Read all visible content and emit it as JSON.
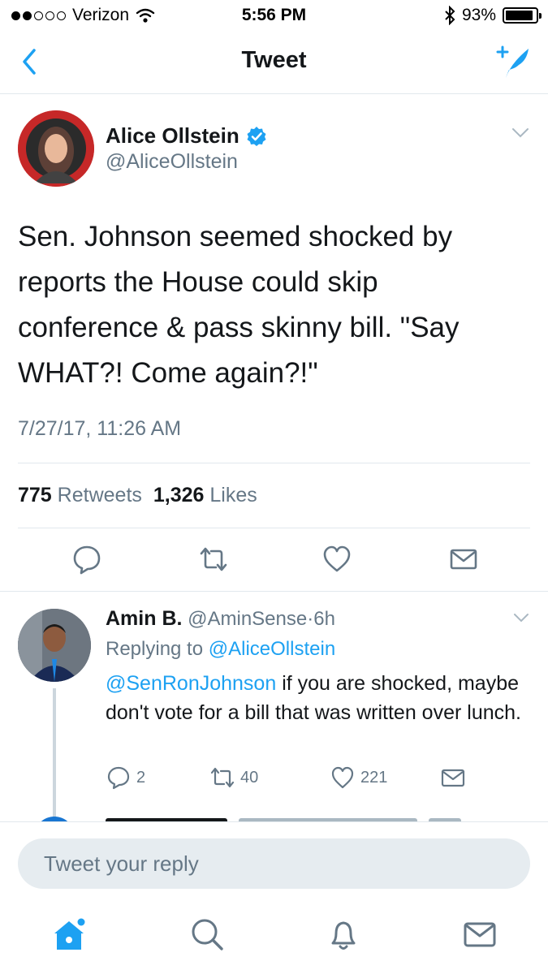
{
  "status_bar": {
    "carrier": "Verizon",
    "time": "5:56 PM",
    "battery": "93%",
    "battery_level": 0.93,
    "icons": [
      "signal-dots-icon",
      "wifi-icon",
      "bluetooth-icon",
      "battery-icon"
    ]
  },
  "nav": {
    "title": "Tweet",
    "back_icon": "chevron-left-icon",
    "compose_icon": "compose-tweet-icon"
  },
  "tweet": {
    "author_name": "Alice Ollstein",
    "author_handle": "@AliceOllstein",
    "verified": true,
    "text": "Sen. Johnson seemed shocked by\nreports the House could skip\nconference & pass skinny bill. \"Say\nWHAT?! Come again?!\"",
    "timestamp": "7/27/17, 11:26 AM",
    "retweets_count": "775",
    "retweets_label": "Retweets",
    "likes_count": "1,326",
    "likes_label": "Likes"
  },
  "reply": {
    "author_name": "Amin B.",
    "author_handle": "@AminSense",
    "separator": "·",
    "age": "6h",
    "replying_prefix": "Replying to",
    "replying_to": "@AliceOllstein",
    "mention": "@SenRonJohnson",
    "text": " if you are shocked, maybe don't vote for a bill that was written over lunch.",
    "replies": "2",
    "retweets": "40",
    "likes": "221"
  },
  "composer": {
    "placeholder": "Tweet your reply"
  },
  "tab_bar": {
    "items": [
      "home-icon",
      "search-icon",
      "notifications-icon",
      "messages-icon"
    ]
  },
  "colors": {
    "accent": "#1da1f2",
    "text": "#14171a",
    "secondary": "#657786",
    "divider": "#e1e8ed"
  }
}
